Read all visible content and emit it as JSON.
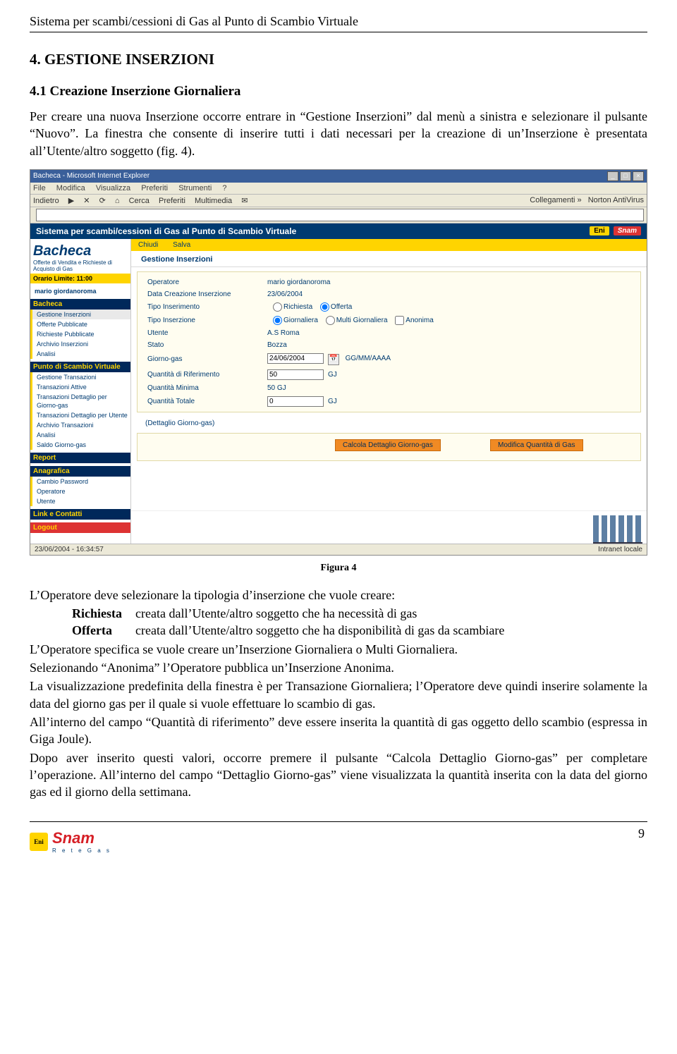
{
  "doc_header": "Sistema per scambi/cessioni di Gas al Punto di Scambio Virtuale",
  "section_title": "4.    GESTIONE INSERZIONI",
  "subsection_title": "4.1    Creazione Inserzione Giornaliera",
  "intro_para": "Per creare una nuova Inserzione occorre entrare in “Gestione Inserzioni” dal menù a sinistra e selezionare il pulsante “Nuovo”. La finestra che consente di inserire tutti i dati necessari per la creazione di un’Inserzione è presentata all’Utente/altro soggetto (fig. 4).",
  "ie": {
    "title": "Bacheca - Microsoft Internet Explorer",
    "menus": [
      "File",
      "Modifica",
      "Visualizza",
      "Preferiti",
      "Strumenti",
      "?"
    ],
    "tb_left": [
      "Indietro",
      "▶",
      "✕",
      "⟳",
      "⌂",
      "Cerca",
      "Preferiti",
      "Multimedia",
      "✉"
    ],
    "tb_right": [
      "Collegamenti »",
      "Norton AntiVirus"
    ],
    "status_left": "23/06/2004 - 16:34:57",
    "status_right": "Intranet locale"
  },
  "app_header": "Sistema per scambi/cessioni di Gas al Punto di Scambio Virtuale",
  "logos": {
    "eni": "Eni",
    "snam": "Snam"
  },
  "sidebar": {
    "bacheca": "Bacheca",
    "bacheca_sub": "Offerte di Vendita e Richieste di Acquisto di Gas",
    "orario": "Orario Limite: 11:00",
    "user": "mario giordanoroma",
    "g1_title": "Bacheca",
    "g1_items": [
      "Gestione Inserzioni",
      "Offerte Pubblicate",
      "Richieste Pubblicate",
      "Archivio Inserzioni",
      "Analisi"
    ],
    "g2_title": "Punto di Scambio Virtuale",
    "g2_items": [
      "Gestione Transazioni",
      "Transazioni Attive",
      "Transazioni Dettaglio per Giorno-gas",
      "Transazioni Dettaglio per Utente",
      "Archivio Transazioni",
      "Analisi",
      "Saldo Giorno-gas"
    ],
    "g3_title": "Report",
    "g4_title": "Anagrafica",
    "g4_items": [
      "Cambio Password",
      "Operatore",
      "Utente"
    ],
    "g5_title": "Link e Contatti",
    "g6_title": "Logout"
  },
  "tabs": {
    "chiudi": "Chiudi",
    "salva": "Salva"
  },
  "panel_title": "Gestione Inserzioni",
  "form": {
    "operatore_l": "Operatore",
    "operatore_v": "mario giordanoroma",
    "datacrea_l": "Data Creazione Inserzione",
    "datacrea_v": "23/06/2004",
    "tipoins_l": "Tipo Inserimento",
    "tipoins_r1": "Richiesta",
    "tipoins_r2": "Offerta",
    "tipoinz_l": "Tipo Inserzione",
    "tipoinz_r1": "Giornaliera",
    "tipoinz_r2": "Multi Giornaliera",
    "tipoinz_c": "Anonima",
    "utente_l": "Utente",
    "utente_v": "A.S Roma",
    "stato_l": "Stato",
    "stato_v": "Bozza",
    "giorno_l": "Giorno-gas",
    "giorno_v": "24/06/2004",
    "giorno_hint": "GG/MM/AAAA",
    "qrif_l": "Quantità di Riferimento",
    "qrif_v": "50",
    "unit": "GJ",
    "qmin_l": "Quantità Minima",
    "qmin_v": "50 GJ",
    "qtot_l": "Quantità Totale",
    "qtot_v": "0",
    "dett_l": "(Dettaglio Giorno-gas)",
    "btn_calc": "Calcola Dettaglio Giorno-gas",
    "btn_mod": "Modifica Quantità di Gas"
  },
  "figure_caption": "Figura 4",
  "body": {
    "p1": "L’Operatore deve selezionare la tipologia d’inserzione che vuole creare:",
    "r_k": "Richiesta",
    "r_v": "creata dall’Utente/altro soggetto che ha necessità di gas",
    "o_k": "Offerta",
    "o_v": "creata dall’Utente/altro soggetto che ha disponibilità di gas da scambiare",
    "p2": "L’Operatore specifica se vuole creare un’Inserzione Giornaliera o Multi Giornaliera.",
    "p3": "Selezionando “Anonima” l’Operatore pubblica un’Inserzione Anonima.",
    "p4": "La visualizzazione predefinita della finestra è per Transazione Giornaliera; l’Operatore deve quindi inserire solamente la data del giorno gas per il quale si vuole effettuare lo scambio di gas.",
    "p5": "All’interno del campo “Quantità di riferimento” deve essere inserita la quantità di gas oggetto dello scambio (espressa in Giga Joule).",
    "p6": "Dopo aver inserito questi valori, occorre premere il pulsante “Calcola Dettaglio Giorno-gas” per completare l’operazione. All’interno del campo “Dettaglio Giorno-gas” viene visualizzata la quantità inserita con la data del giorno gas ed il giorno della settimana."
  },
  "page_number": "9",
  "footer": {
    "eni": "Eni",
    "snam": "Snam",
    "rg": "R e t e   G a s"
  }
}
